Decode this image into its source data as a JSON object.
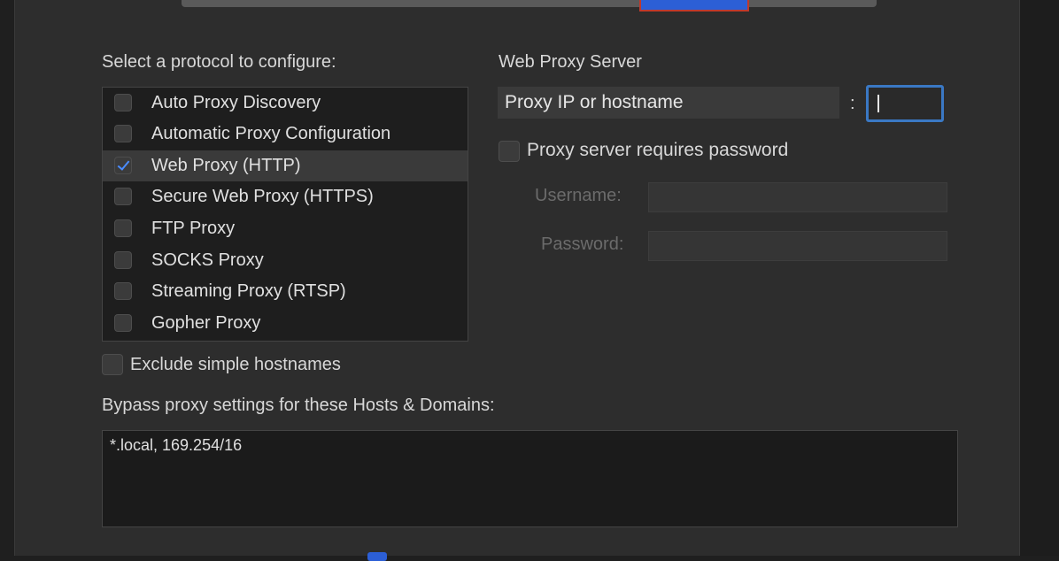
{
  "protocols": {
    "heading": "Select a protocol to configure:",
    "items": [
      {
        "label": "Auto Proxy Discovery",
        "checked": false
      },
      {
        "label": "Automatic Proxy Configuration",
        "checked": false
      },
      {
        "label": "Web Proxy (HTTP)",
        "checked": true
      },
      {
        "label": "Secure Web Proxy (HTTPS)",
        "checked": false
      },
      {
        "label": "FTP Proxy",
        "checked": false
      },
      {
        "label": "SOCKS Proxy",
        "checked": false
      },
      {
        "label": "Streaming Proxy (RTSP)",
        "checked": false
      },
      {
        "label": "Gopher Proxy",
        "checked": false
      }
    ]
  },
  "server": {
    "heading": "Web Proxy Server",
    "host_placeholder": "Proxy IP or hostname",
    "colon": ":",
    "port_value": "",
    "requires_password_label": "Proxy server requires password",
    "username_label": "Username:",
    "password_label": "Password:"
  },
  "exclude_simple": {
    "label": "Exclude simple hostnames",
    "checked": false
  },
  "bypass": {
    "heading": "Bypass proxy settings for these Hosts & Domains:",
    "value": "*.local, 169.254/16"
  },
  "colors": {
    "accent": "#2c5fd6",
    "focus_ring": "#3a78c4",
    "checkmark": "#4a8cff"
  }
}
